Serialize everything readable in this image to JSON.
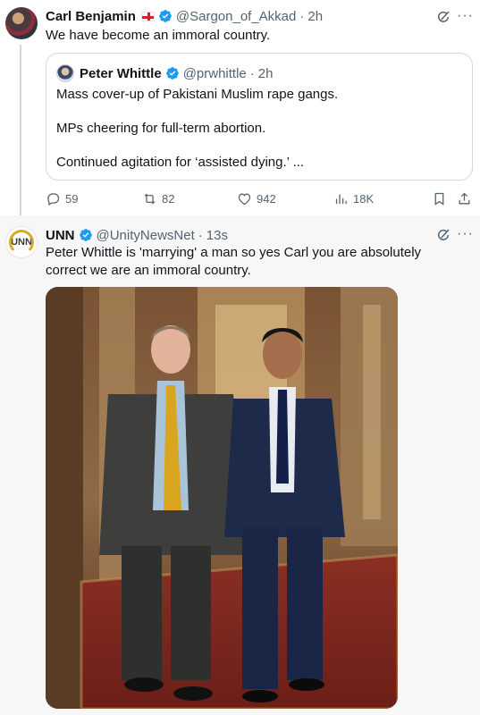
{
  "post1": {
    "author_name": "Carl Benjamin",
    "handle": "@Sargon_of_Akkad",
    "separator": "·",
    "time": "2h",
    "text": "We have become an immoral country.",
    "quote": {
      "author_name": "Peter Whittle",
      "handle": "@prwhittle",
      "separator": "·",
      "time": "2h",
      "lines": [
        "Mass cover-up of Pakistani Muslim rape gangs.",
        "MPs cheering for full-term abortion.",
        "Continued agitation for ‘assisted dying.’ ..."
      ]
    },
    "actions": {
      "replies": "59",
      "reposts": "82",
      "likes": "942",
      "views": "18K"
    }
  },
  "post2": {
    "author_name": "UNN",
    "avatar_text": "UNN",
    "handle": "@UnityNewsNet",
    "separator": "·",
    "time": "13s",
    "text": "Peter Whittle is 'marrying' a man so yes Carl you are absolutely correct we are an immoral country."
  },
  "icons": {
    "verified": "verified-badge-icon",
    "grok": "grok-icon",
    "more": "more-icon",
    "reply": "reply-icon",
    "repost": "repost-icon",
    "like": "like-icon",
    "views": "views-icon",
    "bookmark": "bookmark-icon",
    "share": "share-icon"
  },
  "colors": {
    "verified": "#1d9bf0",
    "text": "#0f1419",
    "muted": "#536471",
    "border": "#cfd9de"
  }
}
